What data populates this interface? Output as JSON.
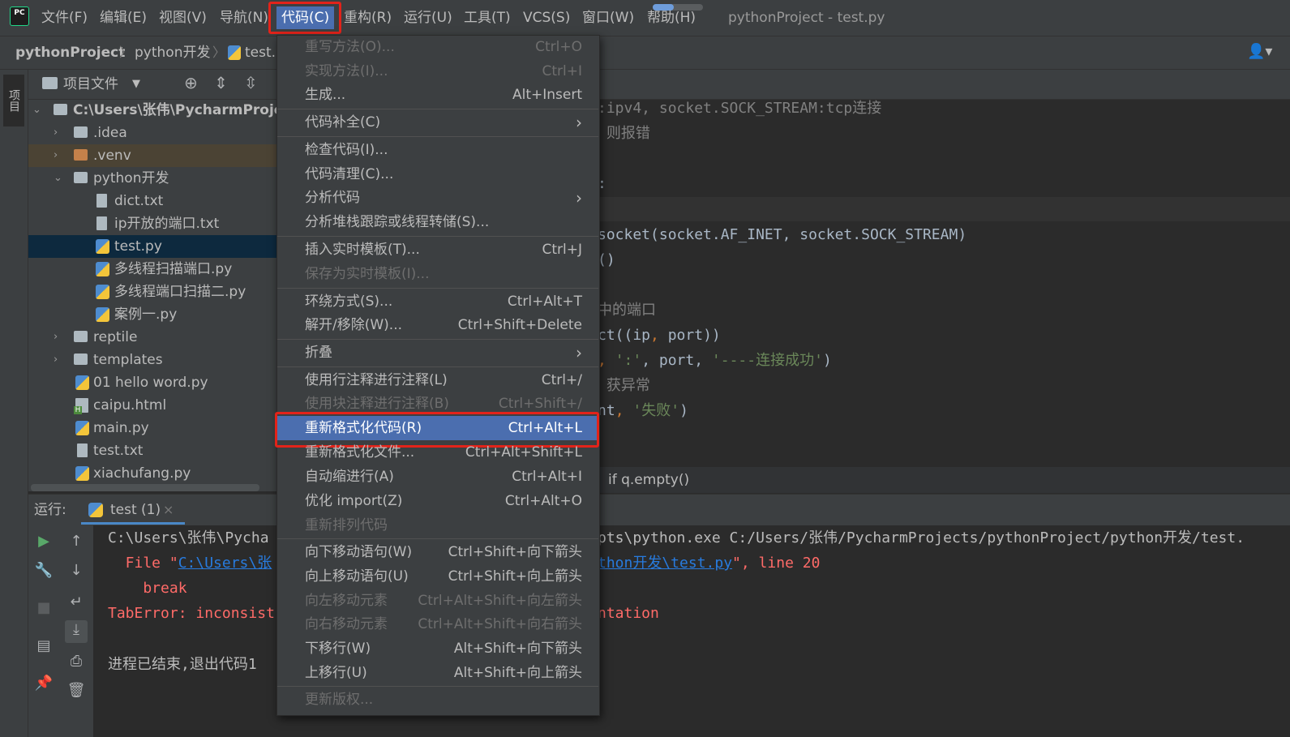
{
  "menubar": {
    "items": [
      "文件(F)",
      "编辑(E)",
      "视图(V)",
      "导航(N)",
      "代码(C)",
      "重构(R)",
      "运行(U)",
      "工具(T)",
      "VCS(S)",
      "窗口(W)",
      "帮助(H)"
    ],
    "window_title": "pythonProject - test.py",
    "logo_text": "PC"
  },
  "navbar": {
    "crumbs": [
      "pythonProject",
      "python开发",
      "test.py"
    ]
  },
  "left_strip": {
    "project_tab": "项目"
  },
  "project": {
    "header_label": "项目文件",
    "tree": [
      {
        "label": "C:\\Users\\张伟\\PycharmProjects\\pythonProject",
        "kind": "folder"
      },
      {
        "label": ".idea",
        "kind": "folder"
      },
      {
        "label": ".venv",
        "kind": "folder-orange"
      },
      {
        "label": "python开发",
        "kind": "folder"
      },
      {
        "label": "dict.txt",
        "kind": "txt"
      },
      {
        "label": "ip开放的端口.txt",
        "kind": "txt"
      },
      {
        "label": "test.py",
        "kind": "py"
      },
      {
        "label": "多线程扫描端口.py",
        "kind": "py"
      },
      {
        "label": "多线程端口扫描二.py",
        "kind": "py"
      },
      {
        "label": "案例一.py",
        "kind": "py"
      },
      {
        "label": "reptile",
        "kind": "folder"
      },
      {
        "label": "templates",
        "kind": "folder"
      },
      {
        "label": "01 hello word.py",
        "kind": "py"
      },
      {
        "label": "caipu.html",
        "kind": "html"
      },
      {
        "label": "main.py",
        "kind": "py"
      },
      {
        "label": "test.txt",
        "kind": "txt"
      },
      {
        "label": "xiachufang.py",
        "kind": "py"
      }
    ]
  },
  "editor": {
    "l1": ":ipv4, socket.SOCK_STREAM:tcp连接",
    "l2": " 则报错",
    "l3": ":",
    "l4": "socket(socket.AF_INET, socket.SOCK_STREAM)",
    "l5": "()",
    "l6": "中的端口",
    "l7a": "ct((ip",
    "l7b": ", ",
    "l7c": "port))",
    "l8a": ", ",
    "l8b": "':'",
    "l8c": ", port, ",
    "l8d": "'----连接成功'",
    "l8e": ")",
    "l9": " 获异常",
    "l10a": "nt",
    "l10b": ", ",
    "l10c": "'失败'",
    "l10d": ")",
    "breadcrumb": "if q.empty()"
  },
  "run": {
    "label": "运行:",
    "tab": "test (1)",
    "tab_close": "×",
    "console": {
      "l1a": "C:\\Users\\张伟\\Pycha",
      "l1b": "pts\\python.exe C:/Users/张伟/PycharmProjects/pythonProject/python开发/test.",
      "l2a": "  File \"",
      "l2b": "C:\\Users\\张",
      "l2c": "thon开发\\test.py",
      "l2d": "\", line 20",
      "l3": "    break",
      "l4a": "TabError: inconsist",
      "l4b": "ntation",
      "l5": "进程已结束,退出代码1"
    }
  },
  "dropdown": {
    "items": [
      {
        "label": "重写方法(O)...",
        "shortcut": "Ctrl+O",
        "disabled": true
      },
      {
        "label": "实现方法(I)...",
        "shortcut": "Ctrl+I",
        "disabled": true
      },
      {
        "label": "生成...",
        "shortcut": "Alt+Insert"
      },
      {
        "label": "代码补全(C)",
        "shortcut": "›"
      },
      {
        "label": "检查代码(I)...",
        "shortcut": ""
      },
      {
        "label": "代码清理(C)...",
        "shortcut": ""
      },
      {
        "label": "分析代码",
        "shortcut": "›"
      },
      {
        "label": "分析堆栈跟踪或线程转储(S)...",
        "shortcut": ""
      },
      {
        "label": "插入实时模板(T)...",
        "shortcut": "Ctrl+J"
      },
      {
        "label": "保存为实时模板(I)...",
        "shortcut": "",
        "disabled": true
      },
      {
        "label": "环绕方式(S)...",
        "shortcut": "Ctrl+Alt+T"
      },
      {
        "label": "解开/移除(W)...",
        "shortcut": "Ctrl+Shift+Delete"
      },
      {
        "label": "折叠",
        "shortcut": "›"
      },
      {
        "label": "使用行注释进行注释(L)",
        "shortcut": "Ctrl+/"
      },
      {
        "label": "使用块注释进行注释(B)",
        "shortcut": "Ctrl+Shift+/",
        "disabled": true
      },
      {
        "label": "重新格式化代码(R)",
        "shortcut": "Ctrl+Alt+L",
        "selected": true
      },
      {
        "label": "重新格式化文件...",
        "shortcut": "Ctrl+Alt+Shift+L"
      },
      {
        "label": "自动缩进行(A)",
        "shortcut": "Ctrl+Alt+I"
      },
      {
        "label": "优化 import(Z)",
        "shortcut": "Ctrl+Alt+O"
      },
      {
        "label": "重新排列代码",
        "shortcut": "",
        "disabled": true
      },
      {
        "label": "向下移动语句(W)",
        "shortcut": "Ctrl+Shift+向下箭头"
      },
      {
        "label": "向上移动语句(U)",
        "shortcut": "Ctrl+Shift+向上箭头"
      },
      {
        "label": "向左移动元素",
        "shortcut": "Ctrl+Alt+Shift+向左箭头",
        "disabled": true
      },
      {
        "label": "向右移动元素",
        "shortcut": "Ctrl+Alt+Shift+向右箭头",
        "disabled": true
      },
      {
        "label": "下移行(W)",
        "shortcut": "Alt+Shift+向下箭头"
      },
      {
        "label": "上移行(U)",
        "shortcut": "Alt+Shift+向上箭头"
      },
      {
        "label": "更新版权...",
        "shortcut": "",
        "disabled": true
      }
    ]
  },
  "colors": {
    "accent_selection": "#4b6eaf",
    "highlight_box": "#e2231a",
    "error_text": "#ff6b68",
    "link": "#287bde"
  }
}
